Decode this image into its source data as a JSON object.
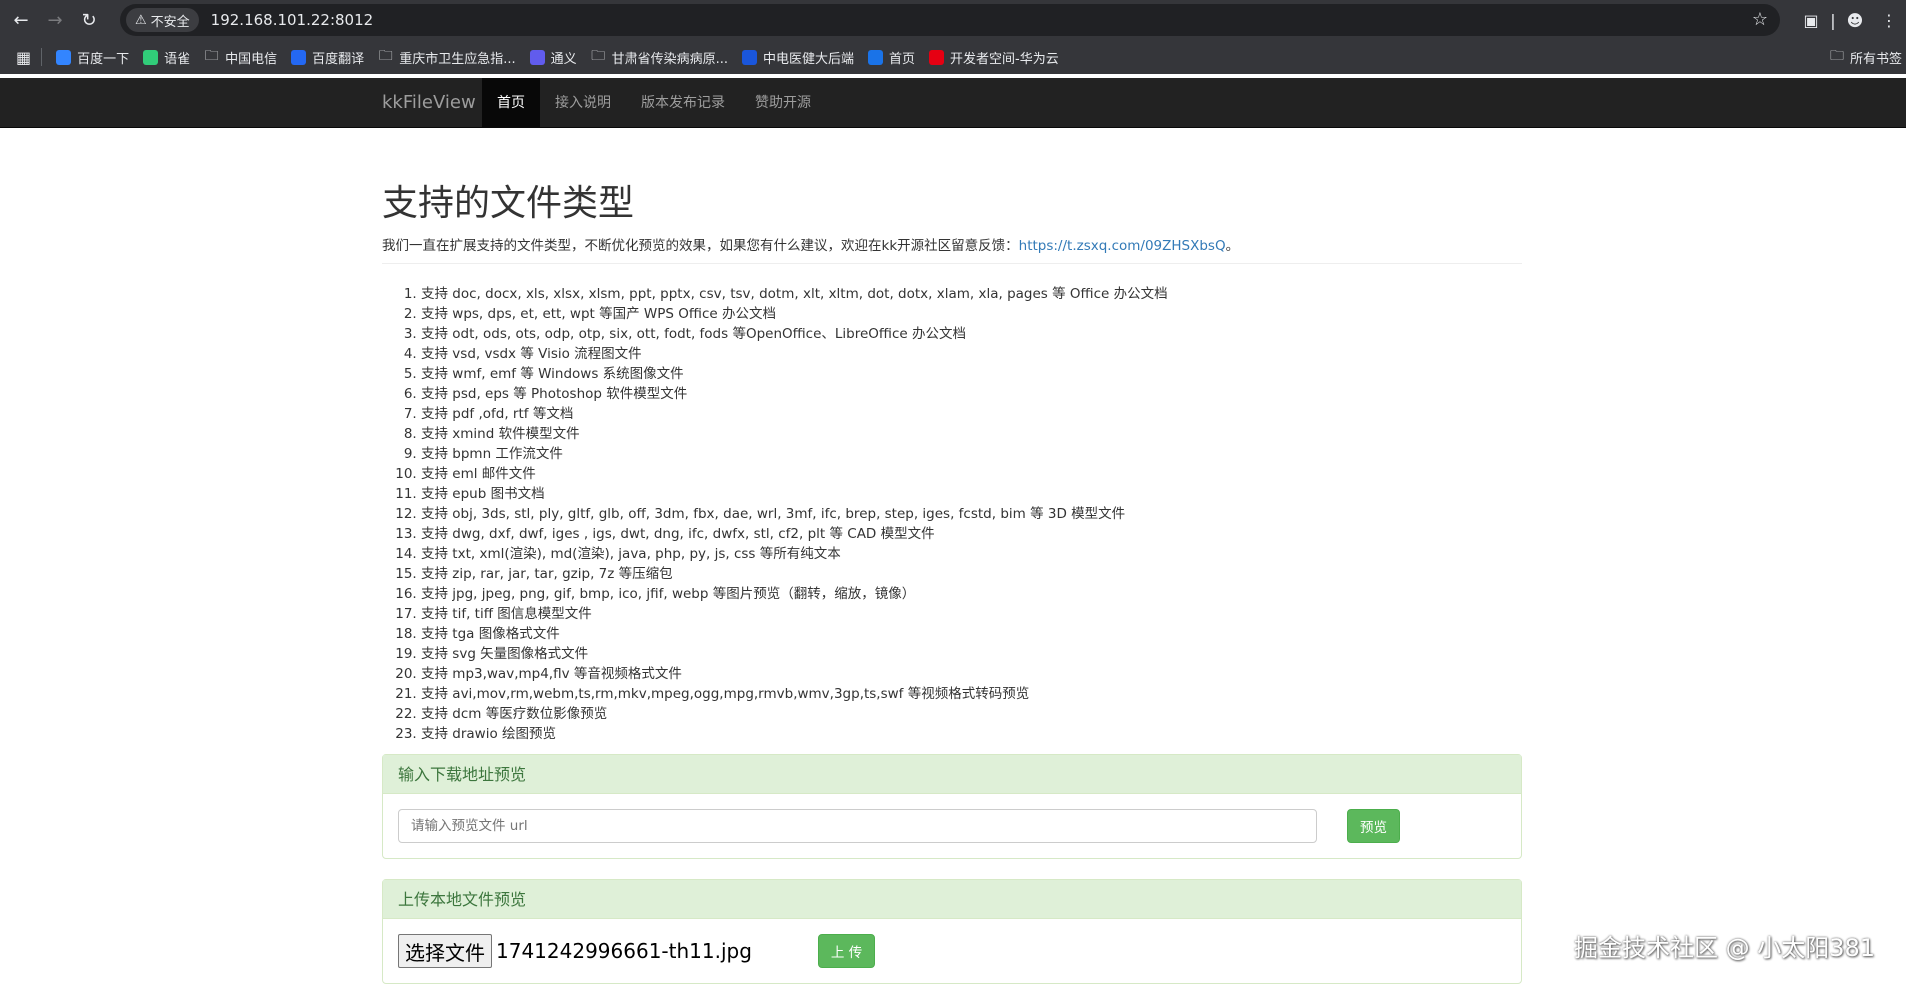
{
  "browser": {
    "security_label": "不安全",
    "url": "192.168.101.22:8012",
    "bookmarks": [
      {
        "label": "百度一下",
        "icon": "baidu-icon",
        "color": "#3385ff"
      },
      {
        "label": "语雀",
        "icon": "yuque-icon",
        "color": "#31cc79"
      },
      {
        "label": "中国电信",
        "icon": "folder-icon",
        "color": ""
      },
      {
        "label": "百度翻译",
        "icon": "translate-icon",
        "color": "#2468f2"
      },
      {
        "label": "重庆市卫生应急指...",
        "icon": "folder-icon",
        "color": ""
      },
      {
        "label": "通义",
        "icon": "tongyi-icon",
        "color": "#615ced"
      },
      {
        "label": "甘肃省传染病病原...",
        "icon": "folder-icon",
        "color": ""
      },
      {
        "label": "中电医健大后端",
        "icon": "shield-icon",
        "color": "#1a56db"
      },
      {
        "label": "首页",
        "icon": "figure-icon",
        "color": "#1a73e8"
      },
      {
        "label": "开发者空间-华为云",
        "icon": "huawei-icon",
        "color": "#e60012"
      }
    ],
    "bookmarks_right": "所有书签"
  },
  "site": {
    "brand": "kkFileView",
    "nav": [
      {
        "label": "首页",
        "active": true
      },
      {
        "label": "接入说明",
        "active": false
      },
      {
        "label": "版本发布记录",
        "active": false
      },
      {
        "label": "赞助开源",
        "active": false
      }
    ]
  },
  "main": {
    "title": "支持的文件类型",
    "lead_text": "我们一直在扩展支持的文件类型，不断优化预览的效果，如果您有什么建议，欢迎在kk开源社区留意反馈：",
    "lead_link": "https://t.zsxq.com/09ZHSXbsQ",
    "lead_end": "。",
    "file_types": [
      "支持 doc, docx, xls, xlsx, xlsm, ppt, pptx, csv, tsv, dotm, xlt, xltm, dot, dotx, xlam, xla, pages 等 Office 办公文档",
      "支持 wps, dps, et, ett, wpt 等国产 WPS Office 办公文档",
      "支持 odt, ods, ots, odp, otp, six, ott, fodt, fods 等OpenOffice、LibreOffice 办公文档",
      "支持 vsd, vsdx 等 Visio 流程图文件",
      "支持 wmf, emf 等 Windows 系统图像文件",
      "支持 psd, eps 等 Photoshop 软件模型文件",
      "支持 pdf ,ofd, rtf 等文档",
      "支持 xmind 软件模型文件",
      "支持 bpmn 工作流文件",
      "支持 eml 邮件文件",
      "支持 epub 图书文档",
      "支持 obj, 3ds, stl, ply, gltf, glb, off, 3dm, fbx, dae, wrl, 3mf, ifc, brep, step, iges, fcstd, bim 等 3D 模型文件",
      "支持 dwg, dxf, dwf, iges , igs, dwt, dng, ifc, dwfx, stl, cf2, plt 等 CAD 模型文件",
      "支持 txt, xml(渲染), md(渲染), java, php, py, js, css 等所有纯文本",
      "支持 zip, rar, jar, tar, gzip, 7z 等压缩包",
      "支持 jpg, jpeg, png, gif, bmp, ico, jfif, webp 等图片预览（翻转，缩放，镜像）",
      "支持 tif, tiff 图信息模型文件",
      "支持 tga 图像格式文件",
      "支持 svg 矢量图像格式文件",
      "支持 mp3,wav,mp4,flv 等音视频格式文件",
      "支持 avi,mov,rm,webm,ts,rm,mkv,mpeg,ogg,mpg,rmvb,wmv,3gp,ts,swf 等视频格式转码预览",
      "支持 dcm 等医疗数位影像预览",
      "支持 drawio 绘图预览"
    ],
    "url_panel": {
      "heading": "输入下载地址预览",
      "placeholder": "请输入预览文件 url",
      "button": "预览"
    },
    "upload_panel": {
      "heading": "上传本地文件预览",
      "choose_button": "选择文件",
      "file_name": "1741242996661-th11.jpg",
      "upload_button": "上 传"
    }
  },
  "watermark": "掘金技术社区 @ 小太阳381"
}
